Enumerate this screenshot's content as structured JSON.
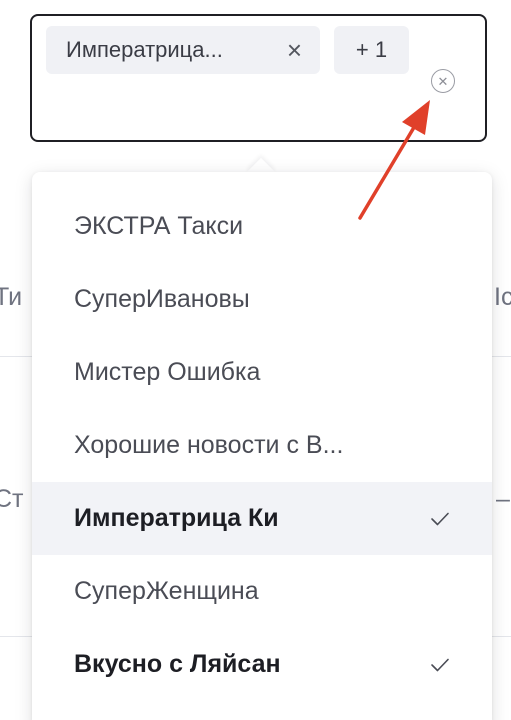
{
  "background_table": {
    "row1_left_fragment": "Ти",
    "row1_right_fragment": "Ic",
    "row2_left_fragment": "Ст",
    "row2_right_fragment": "–"
  },
  "select": {
    "chips": [
      {
        "label": "Императрица...",
        "remove_glyph": "×"
      }
    ],
    "more_chip_label": "+ 1",
    "clear_icon": "clear-circle-icon"
  },
  "dropdown": {
    "options": [
      {
        "label": "ЭКСТРА Такси",
        "selected": false
      },
      {
        "label": "СуперИвановы",
        "selected": false
      },
      {
        "label": "Мистер Ошибка",
        "selected": false
      },
      {
        "label": "Хорошие новости с В...",
        "selected": false
      },
      {
        "label": "Императрица Ки",
        "selected": true
      },
      {
        "label": "СуперЖенщина",
        "selected": false
      },
      {
        "label": "Вкусно с Ляйсан",
        "selected": true
      }
    ]
  },
  "colors": {
    "annotation_arrow": "#e0402a",
    "selected_row_bg": "#f2f3f7",
    "chip_bg": "#f0f1f5"
  }
}
